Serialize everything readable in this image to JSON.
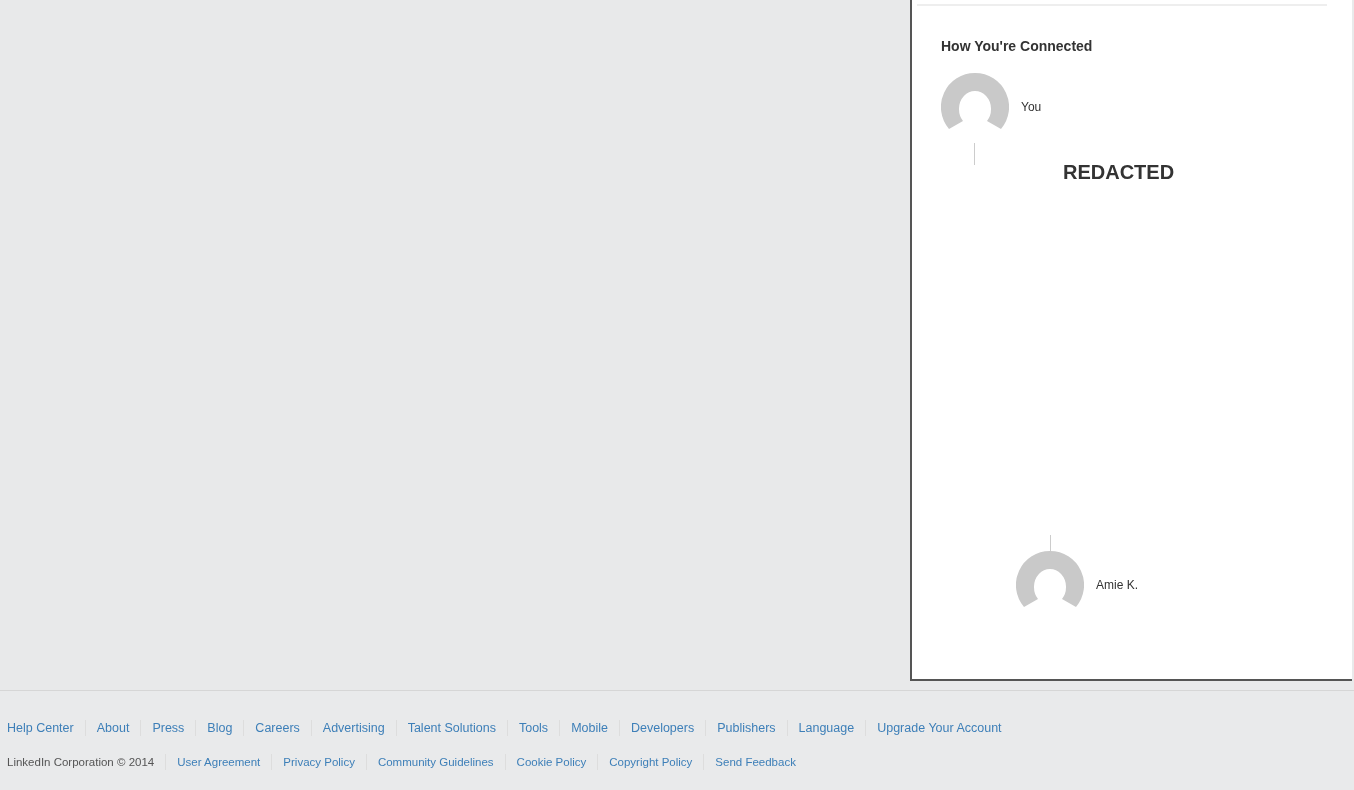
{
  "connections": {
    "title": "How You're Connected",
    "people": [
      {
        "name": "You"
      },
      {
        "name": "Amie K."
      }
    ],
    "redacted": "REDACTED"
  },
  "footer": {
    "links": [
      "Help Center",
      "About",
      "Press",
      "Blog",
      "Careers",
      "Advertising",
      "Talent Solutions",
      "Tools",
      "Mobile",
      "Developers",
      "Publishers",
      "Language",
      "Upgrade Your Account"
    ],
    "copyright": "LinkedIn Corporation © 2014",
    "legal_links": [
      "User Agreement",
      "Privacy Policy",
      "Community Guidelines",
      "Cookie Policy",
      "Copyright Policy",
      "Send Feedback"
    ]
  }
}
